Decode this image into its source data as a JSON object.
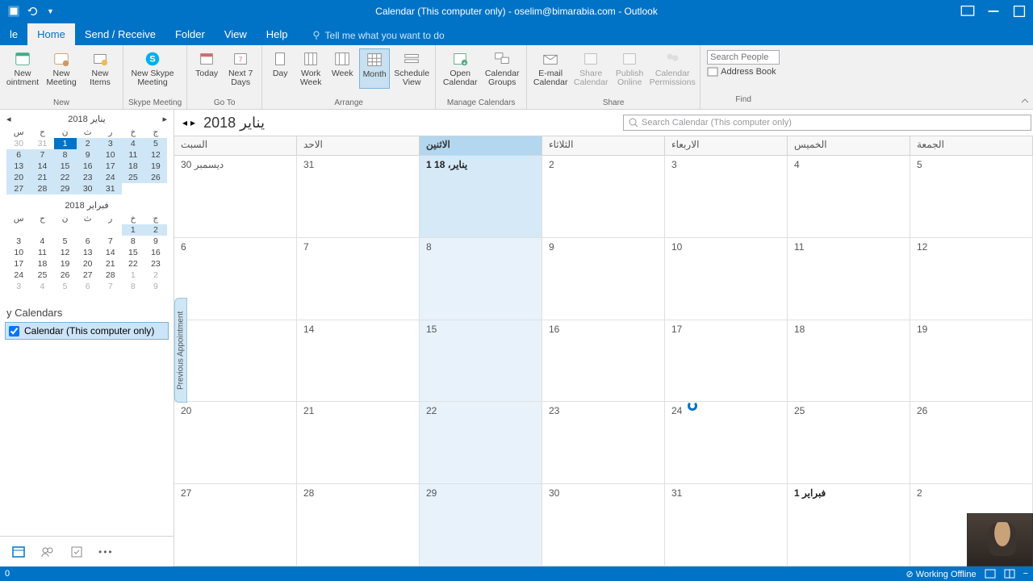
{
  "title": "Calendar (This computer only)  -  oselim@bimarabia.com  -  Outlook",
  "menu": {
    "file": "le",
    "home": "Home",
    "sendrecv": "Send / Receive",
    "folder": "Folder",
    "view": "View",
    "help": "Help",
    "tellme": "Tell me what you want to do"
  },
  "ribbon": {
    "new": {
      "appt": "New ointment",
      "meeting": "New Meeting",
      "items": "New Items",
      "label": "New"
    },
    "skype": {
      "btn": "New Skype Meeting",
      "label": "Skype Meeting"
    },
    "goto": {
      "today": "Today",
      "next7": "Next 7 Days",
      "label": "Go To"
    },
    "arrange": {
      "day": "Day",
      "workweek": "Work Week",
      "week": "Week",
      "month": "Month",
      "sched": "Schedule View",
      "label": "Arrange"
    },
    "manage": {
      "open": "Open Calendar",
      "groups": "Calendar Groups",
      "label": "Manage Calendars"
    },
    "share": {
      "email": "E-mail Calendar",
      "share": "Share Calendar",
      "publish": "Publish Online",
      "perm": "Calendar Permissions",
      "label": "Share"
    },
    "find": {
      "search_ph": "Search People",
      "ab": "Address Book",
      "label": "Find"
    }
  },
  "minical1": {
    "label": "يناير 2018",
    "dow": [
      "س",
      "ح",
      "ن",
      "ث",
      "ر",
      "خ",
      "ج"
    ],
    "rows": [
      [
        "30",
        "31",
        "1",
        "2",
        "3",
        "4",
        "5"
      ],
      [
        "6",
        "7",
        "8",
        "9",
        "10",
        "11",
        "12"
      ],
      [
        "13",
        "14",
        "15",
        "16",
        "17",
        "18",
        "19"
      ],
      [
        "20",
        "21",
        "22",
        "23",
        "24",
        "25",
        "26"
      ],
      [
        "27",
        "28",
        "29",
        "30",
        "31",
        "",
        ""
      ]
    ]
  },
  "minical2": {
    "label": "فبراير 2018",
    "dow": [
      "س",
      "ح",
      "ن",
      "ث",
      "ر",
      "خ",
      "ج"
    ],
    "rows": [
      [
        "",
        "",
        "",
        "",
        "",
        "1",
        "2"
      ],
      [
        "3",
        "4",
        "5",
        "6",
        "7",
        "8",
        "9"
      ],
      [
        "10",
        "11",
        "12",
        "13",
        "14",
        "15",
        "16"
      ],
      [
        "17",
        "18",
        "19",
        "20",
        "21",
        "22",
        "23"
      ],
      [
        "24",
        "25",
        "26",
        "27",
        "28",
        "1",
        "2"
      ],
      [
        "3",
        "4",
        "5",
        "6",
        "7",
        "8",
        "9"
      ]
    ]
  },
  "callist": {
    "hdr": "y Calendars",
    "item": "Calendar (This computer only)"
  },
  "main": {
    "title": "يناير 2018",
    "search_ph": "Search Calendar (This computer only)",
    "dow": [
      "السبت",
      "الاحد",
      "الاثنين",
      "الثلاثاء",
      "الاربعاء",
      "الخميس",
      "الجمعة"
    ],
    "weeks": [
      [
        "ديسمبر 30",
        "31",
        "يناير، 18 1",
        "2",
        "3",
        "4",
        "5"
      ],
      [
        "6",
        "7",
        "8",
        "9",
        "10",
        "11",
        "12"
      ],
      [
        "",
        "14",
        "15",
        "16",
        "17",
        "18",
        "19"
      ],
      [
        "20",
        "21",
        "22",
        "23",
        "24",
        "25",
        "26"
      ],
      [
        "27",
        "28",
        "29",
        "30",
        "31",
        "فبراير 1",
        "2"
      ]
    ],
    "prev": "Previous Appointment"
  },
  "status": {
    "left": "0",
    "offline": "Working Offline"
  }
}
